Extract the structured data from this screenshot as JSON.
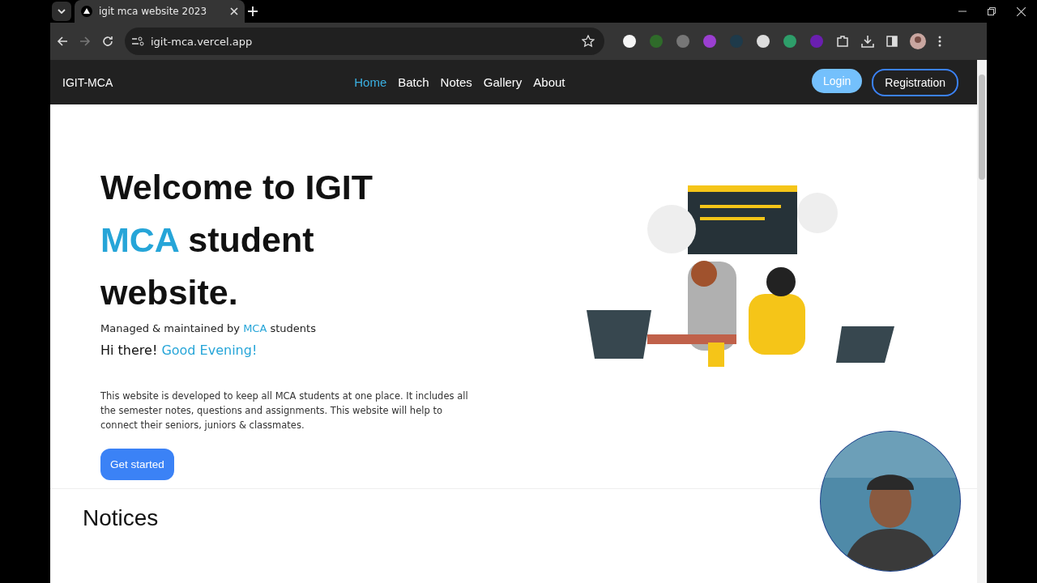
{
  "browser": {
    "tabs": [
      {
        "title": "igit mca website 2023",
        "selected": true
      }
    ],
    "url": "igit-mca.vercel.app"
  },
  "navbar": {
    "brand": "IGIT-MCA",
    "links": [
      {
        "label": "Home",
        "selected": true
      },
      {
        "label": "Batch",
        "selected": false
      },
      {
        "label": "Notes",
        "selected": false
      },
      {
        "label": "Gallery",
        "selected": false
      },
      {
        "label": "About",
        "selected": false
      }
    ],
    "login": "Login",
    "register": "Registration"
  },
  "hero": {
    "title": [
      {
        "text": "Welcome to IGIT",
        "highlight": false
      },
      {
        "text": "MCA",
        "highlight": true
      },
      {
        "text": " student",
        "highlight": false
      },
      {
        "text": "website.",
        "highlight": false
      }
    ],
    "subtitle": [
      {
        "text": "Managed & maintained by ",
        "highlight": false
      },
      {
        "text": "MCA",
        "highlight": true
      },
      {
        "text": " students",
        "highlight": false
      }
    ],
    "greeting": [
      {
        "text": "Hi there! ",
        "highlight": false
      },
      {
        "text": "Good Evening!",
        "highlight": true
      }
    ],
    "description": "This website is developed to keep all MCA students at one place. It includes all the semester notes, questions and assignments. This website will help to connect their seniors, juniors & classmates.",
    "cta": "Get started"
  },
  "notices": {
    "heading": "Notices"
  }
}
